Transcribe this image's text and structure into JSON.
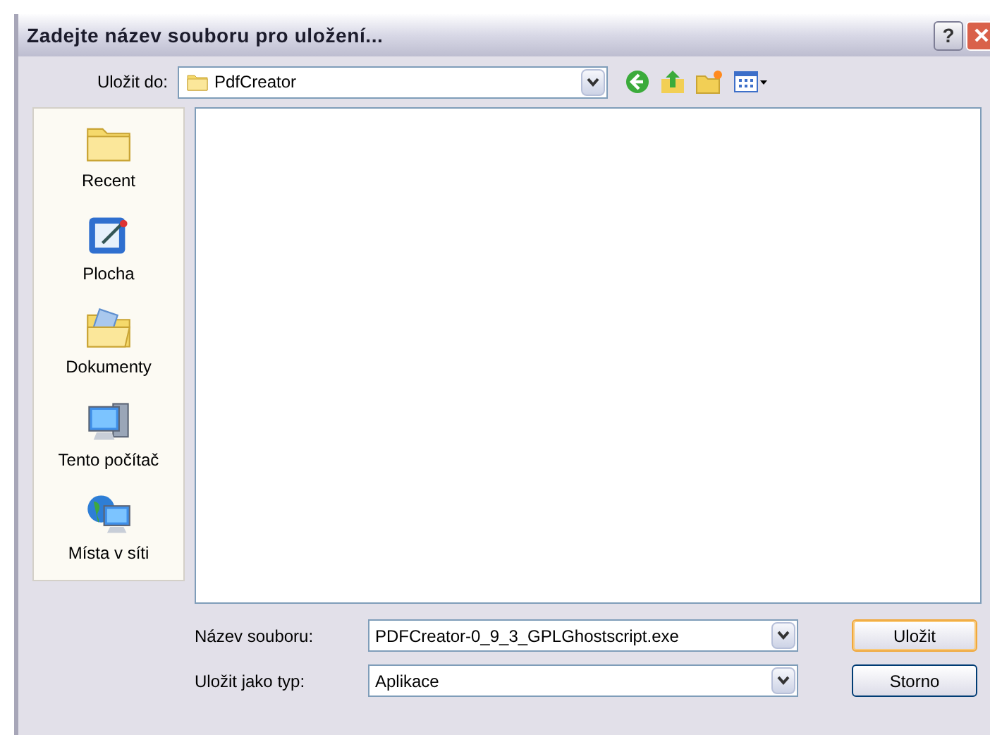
{
  "window": {
    "title": "Zadejte název souboru pro uložení..."
  },
  "title_buttons": [
    {
      "kind": "help",
      "label": "?"
    },
    {
      "kind": "close"
    }
  ],
  "save_in": {
    "label": "Uložit do:",
    "value": "PdfCreator"
  },
  "toolbar": [
    {
      "kind": "back"
    },
    {
      "kind": "up"
    },
    {
      "kind": "new-folder"
    },
    {
      "kind": "views"
    }
  ],
  "places": [
    {
      "label": "Recent",
      "kind": "recent"
    },
    {
      "label": "Plocha",
      "kind": "desktop"
    },
    {
      "label": "Dokumenty",
      "kind": "documents"
    },
    {
      "label": "Tento počítač",
      "kind": "computer"
    },
    {
      "label": "Místa v síti",
      "kind": "network"
    }
  ],
  "file_name": {
    "label": "Název souboru:",
    "value": "PDFCreator-0_9_3_GPLGhostscript.exe"
  },
  "file_type": {
    "label": "Uložit jako typ:",
    "value": "Aplikace"
  },
  "buttons": [
    {
      "label": "Uložit",
      "default": true
    },
    {
      "label": "Storno",
      "default": false
    }
  ]
}
